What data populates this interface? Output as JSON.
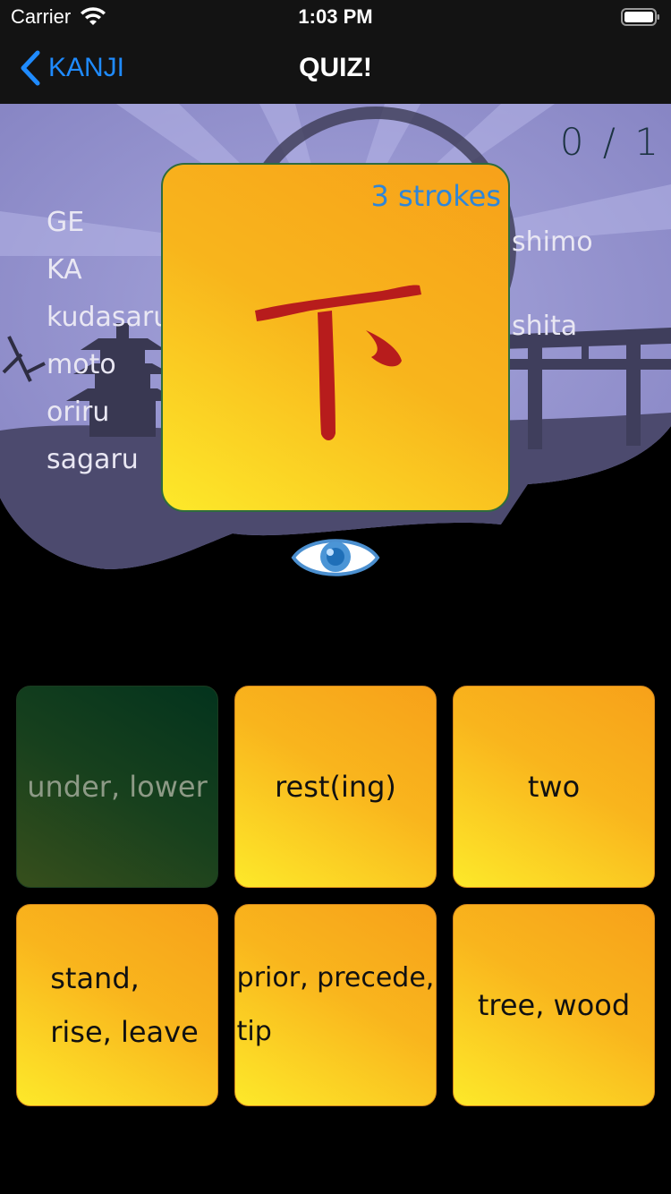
{
  "status_bar": {
    "carrier": "Carrier",
    "time": "1:03 PM"
  },
  "nav": {
    "back_label": "KANJI",
    "title": "QUIZ!"
  },
  "score": "0 / 1",
  "card": {
    "kanji": "下",
    "strokes": "3 strokes"
  },
  "readings_left": [
    "GE",
    "KA",
    "kudasaru",
    "moto",
    "oriru",
    "sagaru"
  ],
  "readings_right": [
    "shimo",
    "shita"
  ],
  "answers": [
    {
      "label": "under, lower",
      "state": "selected-correct"
    },
    {
      "label": "rest(ing)"
    },
    {
      "label": "two"
    },
    {
      "label": "stand,\nrise, leave"
    },
    {
      "label": "prior, precede,\ntip"
    },
    {
      "label": "tree, wood"
    }
  ],
  "colors": {
    "accent": "#1f8bff",
    "card_yellow": "#fde92a",
    "card_orange": "#f7a11a",
    "kanji_red": "#b71c1c",
    "correct_green": "#17401d"
  }
}
